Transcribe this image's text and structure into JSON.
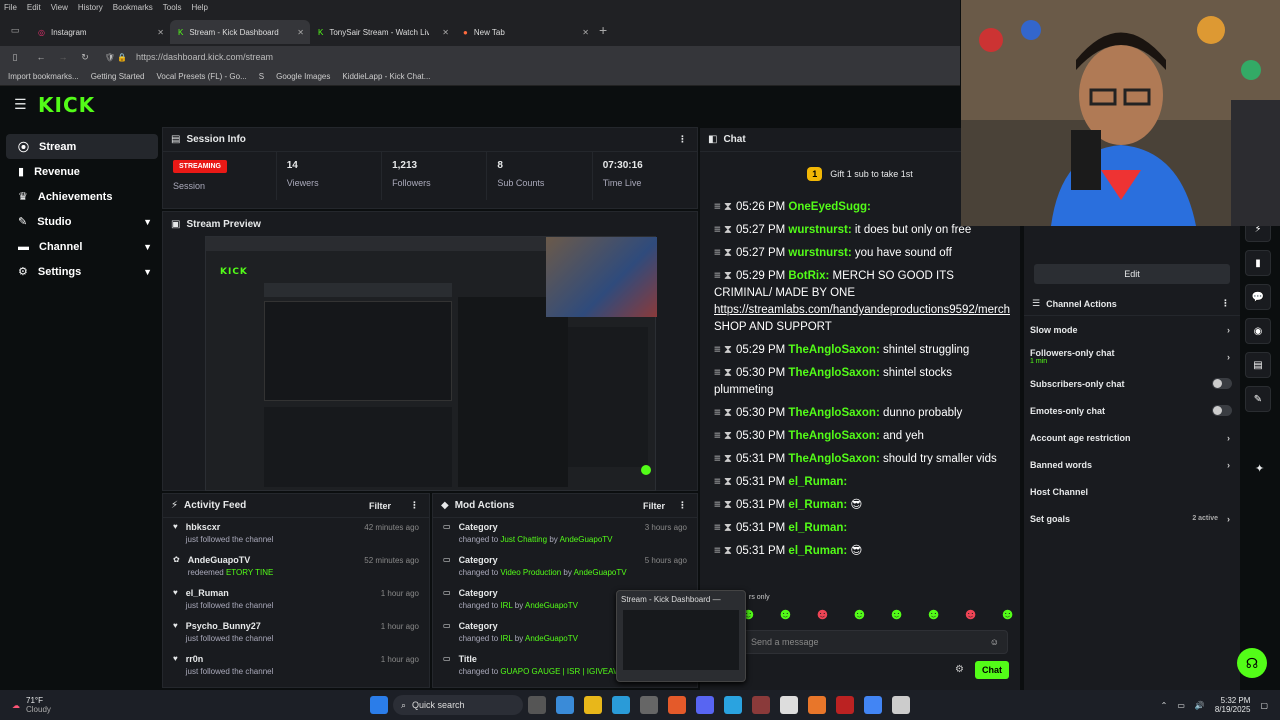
{
  "browser": {
    "menu": [
      "File",
      "Edit",
      "View",
      "History",
      "Bookmarks",
      "Tools",
      "Help"
    ],
    "tabs": [
      {
        "label": "Instagram"
      },
      {
        "label": "Stream - Kick Dashboard"
      },
      {
        "label": "TonySair Stream - Watch Live o"
      },
      {
        "label": "New Tab"
      }
    ],
    "url": "https://dashboard.kick.com/stream",
    "bookmarks": [
      "Import bookmarks...",
      "Getting Started",
      "Vocal Presets (FL) - Go...",
      "S",
      "Google Images",
      "KiddieLapp - Kick Chat..."
    ]
  },
  "brand": {
    "logo": "KICK"
  },
  "sidebar": {
    "items": [
      {
        "label": "Stream",
        "icon": "broadcast-icon"
      },
      {
        "label": "Revenue",
        "icon": "revenue-icon"
      },
      {
        "label": "Achievements",
        "icon": "trophy-icon"
      },
      {
        "label": "Studio",
        "icon": "studio-icon"
      },
      {
        "label": "Channel",
        "icon": "channel-icon"
      },
      {
        "label": "Settings",
        "icon": "gear-icon"
      }
    ]
  },
  "session": {
    "title": "Session Info",
    "status": "STREAMING",
    "status_label": "Session",
    "stats": [
      {
        "value": "14",
        "label": "Viewers"
      },
      {
        "value": "1,213",
        "label": "Followers"
      },
      {
        "value": "8",
        "label": "Sub Counts"
      },
      {
        "value": "07:30:16",
        "label": "Time Live"
      }
    ]
  },
  "preview": {
    "title": "Stream Preview"
  },
  "activity": {
    "title": "Activity Feed",
    "filter": "Filter",
    "items": [
      {
        "name": "hbkscxr",
        "sub": "just followed the channel",
        "time": "42 minutes ago"
      },
      {
        "name": "AndeGuapoTV",
        "sub": "redeemed",
        "highlight": "ETORY TINE",
        "time": "52 minutes ago"
      },
      {
        "name": "el_Ruman",
        "sub": "just followed the channel",
        "time": "1 hour ago"
      },
      {
        "name": "Psycho_Bunny27",
        "sub": "just followed the channel",
        "time": "1 hour ago"
      },
      {
        "name": "rr0n",
        "sub": "just followed the channel",
        "time": "1 hour ago"
      }
    ]
  },
  "mod": {
    "title": "Mod Actions",
    "filter": "Filter",
    "items": [
      {
        "title": "Category",
        "pre": "changed to",
        "hl": "Just Chatting",
        "by": "by",
        "user": "AndeGuapoTV",
        "time": "3 hours ago"
      },
      {
        "title": "Category",
        "pre": "changed to",
        "hl": "Video Production",
        "by": "by",
        "user": "AndeGuapoTV",
        "time": "5 hours ago"
      },
      {
        "title": "Category",
        "pre": "changed to",
        "hl": "IRL",
        "by": "by",
        "user": "AndeGuapoTV",
        "time": ""
      },
      {
        "title": "Category",
        "pre": "changed to",
        "hl": "IRL",
        "by": "by",
        "user": "AndeGuapoTV",
        "time": ""
      },
      {
        "title": "Title",
        "pre": "changed to",
        "hl": "GUAPO GAUGE | ISR | IGIVEAW",
        "by": "",
        "user": "",
        "time": ""
      }
    ]
  },
  "chat": {
    "title": "Chat",
    "gift": "Gift 1 sub to take 1st",
    "messages": [
      {
        "time": "05:26 PM",
        "user": "OneEyedSugg:",
        "text": ""
      },
      {
        "time": "05:27 PM",
        "user": "wurstnurst:",
        "text": "it does but only on free"
      },
      {
        "time": "05:27 PM",
        "user": "wurstnurst:",
        "text": "you have sound off"
      },
      {
        "time": "05:29 PM",
        "user": "BotRix:",
        "text": "MERCH SO GOOD ITS CRIMINAL/ MADE BY ONE",
        "link": "https://streamlabs.com/handyandeproductions9592/merch",
        "tail": "SHOP AND SUPPORT"
      },
      {
        "time": "05:29 PM",
        "user": "TheAngloSaxon:",
        "text": "shintel struggling"
      },
      {
        "time": "05:30 PM",
        "user": "TheAngloSaxon:",
        "text": "shintel stocks plummeting"
      },
      {
        "time": "05:30 PM",
        "user": "TheAngloSaxon:",
        "text": "dunno probably"
      },
      {
        "time": "05:30 PM",
        "user": "TheAngloSaxon:",
        "text": "and yeh"
      },
      {
        "time": "05:31 PM",
        "user": "TheAngloSaxon:",
        "text": "should try smaller vids"
      },
      {
        "time": "05:31 PM",
        "user": "el_Ruman:",
        "text": ""
      },
      {
        "time": "05:31 PM",
        "user": "el_Ruman:",
        "text": "😎"
      },
      {
        "time": "05:31 PM",
        "user": "el_Ruman:",
        "text": ""
      },
      {
        "time": "05:31 PM",
        "user": "el_Ruman:",
        "text": "😎"
      }
    ],
    "placeholder": "Send a message",
    "send": "Chat",
    "popup": "Stream - Kick Dashboard —",
    "popup_sub": "rs only"
  },
  "right": {
    "edit": "Edit",
    "title": "Channel Actions",
    "items": [
      {
        "label": "Slow mode",
        "control": "chevron"
      },
      {
        "label": "Followers-only chat",
        "sub": "1 min",
        "control": "chevron"
      },
      {
        "label": "Subscribers-only chat",
        "control": "toggle"
      },
      {
        "label": "Emotes-only chat",
        "control": "toggle"
      },
      {
        "label": "Account age restriction",
        "control": "chevron"
      },
      {
        "label": "Banned words",
        "control": "chevron"
      },
      {
        "label": "Host Channel",
        "control": "none"
      },
      {
        "label": "Set goals",
        "sub": "2 active",
        "control": "chevron"
      }
    ]
  },
  "taskbar": {
    "weather": "71°F",
    "weather_sub": "Cloudy",
    "search": "Quick search",
    "time": "5:32 PM",
    "date": "8/19/2025"
  },
  "colors": {
    "accent": "#53fc18",
    "live": "#e91916",
    "bg": "#0b0e0f",
    "panel": "#191b1f"
  }
}
